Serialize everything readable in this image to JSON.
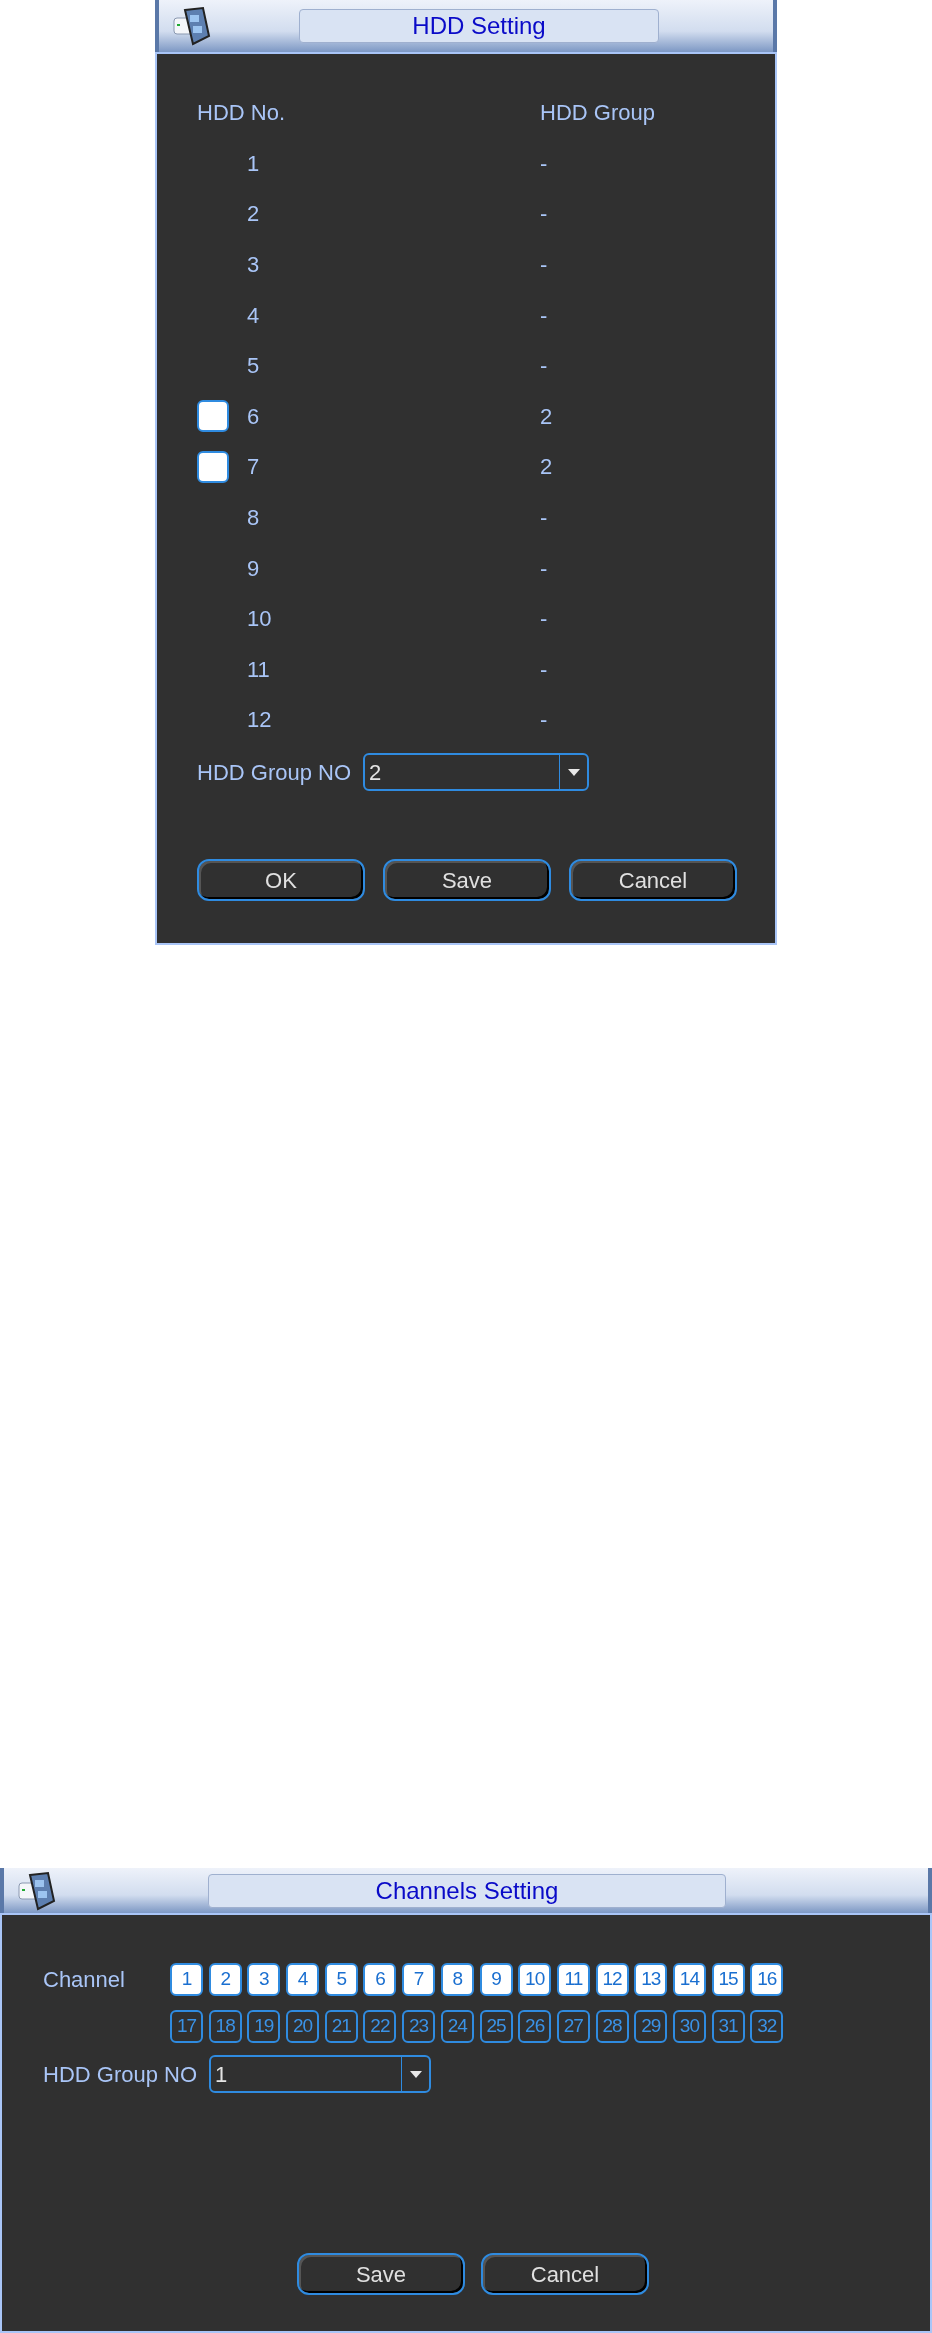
{
  "hdd_dialog": {
    "title": "HDD Setting",
    "columns": [
      "HDD No.",
      "HDD Group"
    ],
    "rows": [
      {
        "kind": "plain",
        "number": "1",
        "group": "-"
      },
      {
        "kind": "plain",
        "number": "2",
        "group": "-"
      },
      {
        "kind": "plain",
        "number": "3",
        "group": "-"
      },
      {
        "kind": "plain",
        "number": "4",
        "group": "-"
      },
      {
        "kind": "plain",
        "number": "5",
        "group": "-"
      },
      {
        "kind": "checkbox",
        "checked": false,
        "number": "6",
        "group": "2"
      },
      {
        "kind": "checkbox",
        "checked": false,
        "number": "7",
        "group": "2"
      },
      {
        "kind": "plain",
        "number": "8",
        "group": "-"
      },
      {
        "kind": "plain",
        "number": "9",
        "group": "-"
      },
      {
        "kind": "plain",
        "number": "10",
        "group": "-"
      },
      {
        "kind": "plain",
        "number": "11",
        "group": "-"
      },
      {
        "kind": "plain",
        "number": "12",
        "group": "-"
      }
    ],
    "group_field": {
      "label": "HDD Group NO",
      "value": "2"
    },
    "buttons": [
      "OK",
      "Save",
      "Cancel"
    ]
  },
  "channels_dialog": {
    "title": "Channels Setting",
    "channel_label": "Channel",
    "channels": [
      {
        "label": "1",
        "selected": true
      },
      {
        "label": "2",
        "selected": true
      },
      {
        "label": "3",
        "selected": true
      },
      {
        "label": "4",
        "selected": true
      },
      {
        "label": "5",
        "selected": true
      },
      {
        "label": "6",
        "selected": true
      },
      {
        "label": "7",
        "selected": true
      },
      {
        "label": "8",
        "selected": true
      },
      {
        "label": "9",
        "selected": true
      },
      {
        "label": "10",
        "selected": true
      },
      {
        "label": "11",
        "selected": true
      },
      {
        "label": "12",
        "selected": true
      },
      {
        "label": "13",
        "selected": true
      },
      {
        "label": "14",
        "selected": true
      },
      {
        "label": "15",
        "selected": true
      },
      {
        "label": "16",
        "selected": true
      },
      {
        "label": "17",
        "selected": false
      },
      {
        "label": "18",
        "selected": false
      },
      {
        "label": "19",
        "selected": false
      },
      {
        "label": "20",
        "selected": false
      },
      {
        "label": "21",
        "selected": false
      },
      {
        "label": "22",
        "selected": false
      },
      {
        "label": "23",
        "selected": false
      },
      {
        "label": "24",
        "selected": false
      },
      {
        "label": "25",
        "selected": false
      },
      {
        "label": "26",
        "selected": false
      },
      {
        "label": "27",
        "selected": false
      },
      {
        "label": "28",
        "selected": false
      },
      {
        "label": "29",
        "selected": false
      },
      {
        "label": "30",
        "selected": false
      },
      {
        "label": "31",
        "selected": false
      },
      {
        "label": "32",
        "selected": false
      }
    ],
    "group_field": {
      "label": "HDD Group NO",
      "value": "1"
    },
    "buttons": [
      "Save",
      "Cancel"
    ]
  }
}
